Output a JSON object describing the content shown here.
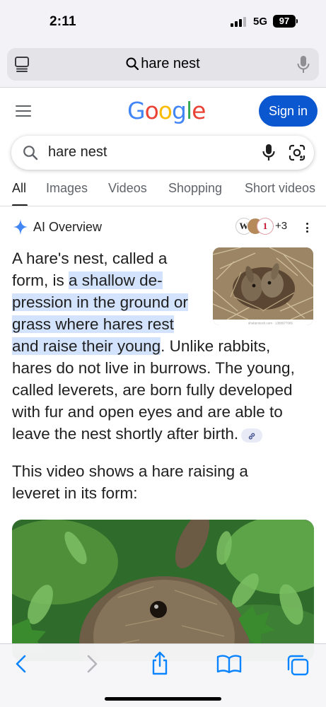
{
  "status_bar": {
    "time": "2:11",
    "network": "5G",
    "battery": "97"
  },
  "address_bar": {
    "url_text": "hare nest"
  },
  "google": {
    "logo_letters": [
      {
        "ch": "G",
        "color": "#4285F4"
      },
      {
        "ch": "o",
        "color": "#EA4335"
      },
      {
        "ch": "o",
        "color": "#FBBC05"
      },
      {
        "ch": "g",
        "color": "#4285F4"
      },
      {
        "ch": "l",
        "color": "#34A853"
      },
      {
        "ch": "e",
        "color": "#EA4335"
      }
    ],
    "sign_in_label": "Sign in"
  },
  "search": {
    "query": "hare nest"
  },
  "tabs": [
    "All",
    "Images",
    "Videos",
    "Shopping",
    "Short videos"
  ],
  "ai_overview": {
    "title": "AI Overview",
    "sources_more": "+3",
    "paragraph": {
      "lead": "A hare's nest, called a form, is ",
      "highlight": "a shallow de-pression in the ground or grass where hares rest and raise their young",
      "rest": ". Unlike rabbits, hares do not live in burrows. The young, called leverets, are born fully developed with fur and open eyes and are able to leave the nest shortly after birth."
    },
    "thumbnail_caption": "shutterstock.com · 1388977085",
    "video_intro": "This video shows a hare raising a leveret in its form:"
  },
  "icons": {
    "search": "search-icon",
    "mic": "mic-icon",
    "lens": "camera-lens-icon",
    "tabs": "tab-overview-icon",
    "back": "back-chevron-icon",
    "forward": "forward-chevron-icon",
    "share": "share-icon",
    "bookmarks": "bookmarks-icon",
    "all_tabs": "tabs-icon"
  },
  "colors": {
    "accent": "#0b57d0",
    "highlight": "#d3e3fd",
    "toolbar_active": "#0a84ff"
  }
}
